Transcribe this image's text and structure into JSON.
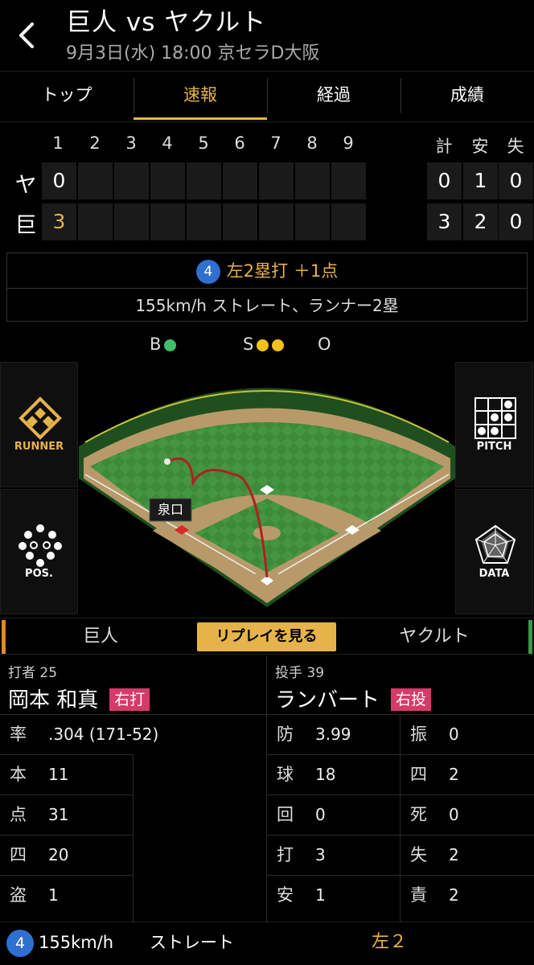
{
  "header": {
    "title": "巨人 vs ヤクルト",
    "subtitle": "9月3日(水) 18:00 京セラD大阪"
  },
  "tabs": [
    "トップ",
    "速報",
    "経過",
    "成績"
  ],
  "active_tab": "速報",
  "scoreboard": {
    "innings": [
      "1",
      "2",
      "3",
      "4",
      "5",
      "6",
      "7",
      "8",
      "9"
    ],
    "totals_headers": [
      "計",
      "安",
      "失"
    ],
    "rows": [
      {
        "team": "ヤ",
        "innings": [
          "0",
          "",
          "",
          "",
          "",
          "",
          "",
          "",
          ""
        ],
        "totals": [
          "0",
          "1",
          "0"
        ]
      },
      {
        "team": "巨",
        "innings": [
          "3",
          "",
          "",
          "",
          "",
          "",
          "",
          "",
          ""
        ],
        "totals": [
          "3",
          "2",
          "0"
        ]
      }
    ]
  },
  "play": {
    "number": "4",
    "result": "左2塁打 ＋1点",
    "detail": "155km/h ストレート、ランナー2塁"
  },
  "count": {
    "b_label": "B",
    "s_label": "S",
    "o_label": "O",
    "balls": 1,
    "strikes": 2,
    "outs": 0
  },
  "field": {
    "runner_label": "泉口"
  },
  "side_buttons": {
    "runner": "RUNNER",
    "pitch": "PITCH",
    "pos": "POS.",
    "data": "DATA"
  },
  "teambar": {
    "home": "巨人",
    "replay": "リプレイを見る",
    "away": "ヤクルト"
  },
  "batter": {
    "role": "打者 25",
    "name": "岡本 和真",
    "hand": "右打",
    "stats": [
      {
        "k": "率",
        "v": ".304 (171-52)"
      },
      {
        "k": "本",
        "v": "11"
      },
      {
        "k": "点",
        "v": "31"
      },
      {
        "k": "四",
        "v": "20"
      },
      {
        "k": "盗",
        "v": "1"
      }
    ]
  },
  "pitcher": {
    "role": "投手 39",
    "name": "ランバート",
    "hand": "右投",
    "stats_left": [
      {
        "k": "防",
        "v": "3.99"
      },
      {
        "k": "球",
        "v": "18"
      },
      {
        "k": "回",
        "v": "0"
      },
      {
        "k": "打",
        "v": "3"
      },
      {
        "k": "安",
        "v": "1"
      }
    ],
    "stats_right": [
      {
        "k": "振",
        "v": "0"
      },
      {
        "k": "四",
        "v": "2"
      },
      {
        "k": "死",
        "v": "0"
      },
      {
        "k": "失",
        "v": "2"
      },
      {
        "k": "責",
        "v": "2"
      }
    ]
  },
  "bottom": {
    "number": "4",
    "speed": "155km/h",
    "pitch": "ストレート",
    "result": "左２"
  },
  "colors": {
    "accent": "#e6b34a",
    "ball": "#3fbf6a",
    "strike": "#f2c21c",
    "hand_badge": "#d63a6a",
    "play_circle": "#2f6fd0"
  }
}
